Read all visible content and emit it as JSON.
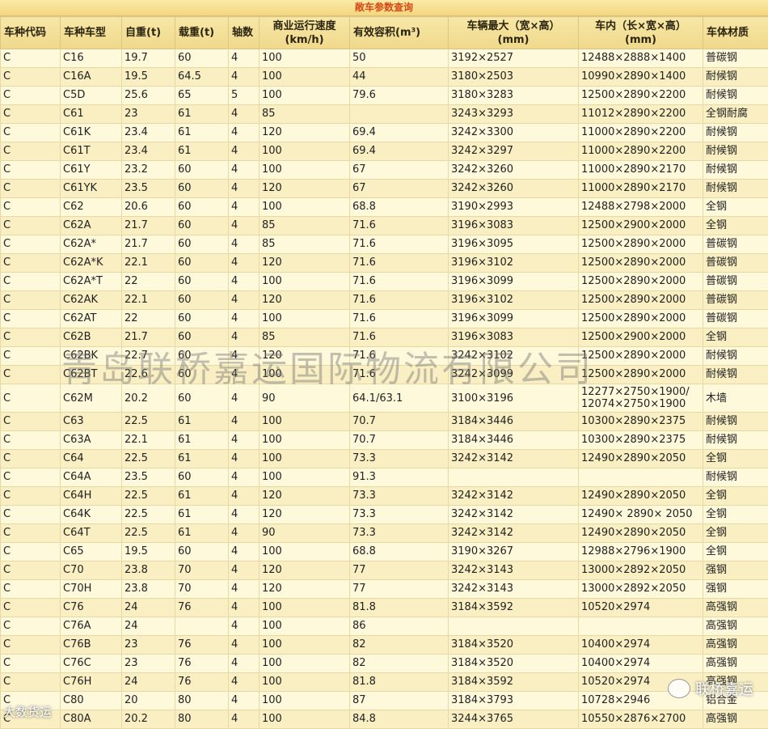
{
  "title": "敞车参数查询",
  "headers": [
    "车种代码",
    "车种车型",
    "自重(t)",
    "载重(t)",
    "轴数",
    "商业运行速度\n(km/h)",
    "有效容积(m³)",
    "车辆最大（宽×高）\n(mm)",
    "车内（长×宽×高）\n(mm)",
    "车体材质"
  ],
  "rows": [
    [
      "C",
      "C16",
      "19.7",
      "60",
      "4",
      "100",
      "50",
      "3192×2527",
      "12488×2888×1400",
      "普碳钢"
    ],
    [
      "C",
      "C16A",
      "19.5",
      "64.5",
      "4",
      "100",
      "44",
      "3180×2503",
      "10990×2890×1400",
      "耐候钢"
    ],
    [
      "C",
      "C5D",
      "25.6",
      "65",
      "5",
      "100",
      "79.6",
      "3180×3283",
      "12500×2890×2200",
      "耐候钢"
    ],
    [
      "C",
      "C61",
      "23",
      "61",
      "4",
      "85",
      "",
      "3243×3293",
      "11012×2890×2200",
      "全钢耐腐"
    ],
    [
      "C",
      "C61K",
      "23.4",
      "61",
      "4",
      "120",
      "69.4",
      "3242×3300",
      "11000×2890×2200",
      "耐候钢"
    ],
    [
      "C",
      "C61T",
      "23.4",
      "61",
      "4",
      "100",
      "69.4",
      "3242×3297",
      "11000×2890×2200",
      "耐候钢"
    ],
    [
      "C",
      "C61Y",
      "23.2",
      "60",
      "4",
      "100",
      "67",
      "3242×3260",
      "11000×2890×2170",
      "耐候钢"
    ],
    [
      "C",
      "C61YK",
      "23.5",
      "60",
      "4",
      "120",
      "67",
      "3242×3260",
      "11000×2890×2170",
      "耐候钢"
    ],
    [
      "C",
      "C62",
      "20.6",
      "60",
      "4",
      "100",
      "68.8",
      "3190×2993",
      "12488×2798×2000",
      "全钢"
    ],
    [
      "C",
      "C62A",
      "21.7",
      "60",
      "4",
      "85",
      "71.6",
      "3196×3083",
      "12500×2900×2000",
      "全钢"
    ],
    [
      "C",
      "C62A*",
      "21.7",
      "60",
      "4",
      "85",
      "71.6",
      "3196×3095",
      "12500×2890×2000",
      "普碳钢"
    ],
    [
      "C",
      "C62A*K",
      "22.1",
      "60",
      "4",
      "120",
      "71.6",
      "3196×3102",
      "12500×2890×2000",
      "普碳钢"
    ],
    [
      "C",
      "C62A*T",
      "22",
      "60",
      "4",
      "100",
      "71.6",
      "3196×3099",
      "12500×2890×2000",
      "普碳钢"
    ],
    [
      "C",
      "C62AK",
      "22.1",
      "60",
      "4",
      "120",
      "71.6",
      "3196×3102",
      "12500×2890×2000",
      "普碳钢"
    ],
    [
      "C",
      "C62AT",
      "22",
      "60",
      "4",
      "100",
      "71.6",
      "3196×3099",
      "12500×2890×2000",
      "普碳钢"
    ],
    [
      "C",
      "C62B",
      "21.7",
      "60",
      "4",
      "85",
      "71.6",
      "3196×3083",
      "12500×2900×2000",
      "全钢"
    ],
    [
      "C",
      "C62BK",
      "22.7",
      "60",
      "4",
      "120",
      "71.6",
      "3242×3102",
      "12500×2890×2000",
      "耐候钢"
    ],
    [
      "C",
      "C62BT",
      "22.6",
      "60",
      "4",
      "100",
      "71.6",
      "3242×3099",
      "12500×2890×2000",
      "耐候钢"
    ],
    [
      "C",
      "C62M",
      "20.2",
      "60",
      "4",
      "90",
      "64.1/63.1",
      "3100×3196",
      "12277×2750×1900/\n12074×2750×1900",
      "木墙"
    ],
    [
      "C",
      "C63",
      "22.5",
      "61",
      "4",
      "100",
      "70.7",
      "3184×3446",
      "10300×2890×2375",
      "耐候钢"
    ],
    [
      "C",
      "C63A",
      "22.1",
      "61",
      "4",
      "100",
      "70.7",
      "3184×3446",
      "10300×2890×2375",
      "耐候钢"
    ],
    [
      "C",
      "C64",
      "22.5",
      "61",
      "4",
      "100",
      "73.3",
      "3242×3142",
      "12490×2890×2050",
      "全钢"
    ],
    [
      "C",
      "C64A",
      "23.5",
      "60",
      "4",
      "100",
      "91.3",
      "",
      "",
      "耐候钢"
    ],
    [
      "C",
      "C64H",
      "22.5",
      "61",
      "4",
      "120",
      "73.3",
      "3242×3142",
      "12490×2890×2050",
      "全钢"
    ],
    [
      "C",
      "C64K",
      "22.5",
      "61",
      "4",
      "120",
      "73.3",
      "3242×3142",
      "12490× 2890× 2050",
      "全钢"
    ],
    [
      "C",
      "C64T",
      "22.5",
      "61",
      "4",
      "90",
      "73.3",
      "3242×3142",
      "12490×2890×2050",
      "全钢"
    ],
    [
      "C",
      "C65",
      "19.5",
      "60",
      "4",
      "100",
      "68.8",
      "3190×3267",
      "12988×2796×1900",
      "全钢"
    ],
    [
      "C",
      "C70",
      "23.8",
      "70",
      "4",
      "120",
      "77",
      "3242×3143",
      "13000×2892×2050",
      "强钢"
    ],
    [
      "C",
      "C70H",
      "23.8",
      "70",
      "4",
      "120",
      "77",
      "3242×3143",
      "13000×2892×2050",
      "强钢"
    ],
    [
      "C",
      "C76",
      "24",
      "76",
      "4",
      "100",
      "81.8",
      "3184×3592",
      "10520×2974",
      "高强钢"
    ],
    [
      "C",
      "C76A",
      "24",
      "",
      "4",
      "100",
      "86",
      "",
      "",
      "高强钢"
    ],
    [
      "C",
      "C76B",
      "23",
      "76",
      "4",
      "100",
      "82",
      "3184×3520",
      "10400×2974",
      "高强钢"
    ],
    [
      "C",
      "C76C",
      "23",
      "76",
      "4",
      "100",
      "82",
      "3184×3520",
      "10400×2974",
      "高强钢"
    ],
    [
      "C",
      "C76H",
      "24",
      "76",
      "4",
      "100",
      "81.8",
      "3184×3592",
      "10520×2974",
      "高强钢"
    ],
    [
      "C",
      "C80",
      "20",
      "80",
      "4",
      "100",
      "87",
      "3184×3793",
      "10728×2946",
      "铝合金"
    ],
    [
      "C",
      "C80A",
      "20.2",
      "80",
      "4",
      "100",
      "84.8",
      "3244×3765",
      "10550×2876×2700",
      "高强钢"
    ]
  ],
  "watermark": "青岛联桥嘉运国际物流有限公司",
  "wechat_label": "联桥嘉运",
  "corner_label": "大数货运"
}
